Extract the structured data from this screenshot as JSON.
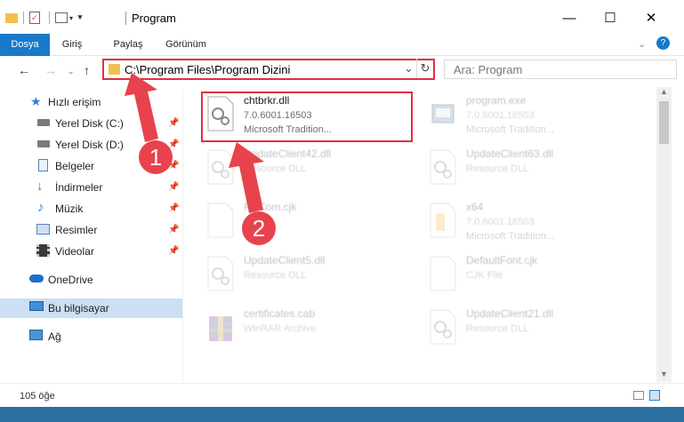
{
  "window": {
    "title": "Program",
    "minimize": "—",
    "maximize": "☐",
    "close": "✕"
  },
  "ribbon": {
    "tabs": [
      "Dosya",
      "Giriş",
      "Paylaş",
      "Görünüm"
    ]
  },
  "address": {
    "path": "C:\\Program Files\\Program Dizini",
    "search_placeholder": "Ara: Program"
  },
  "sidebar": {
    "items": [
      {
        "label": "Hızlı erişim",
        "icon": "star-icon"
      },
      {
        "label": "Yerel Disk (C:)",
        "icon": "drive-icon"
      },
      {
        "label": "Yerel Disk (D:)",
        "icon": "drive-icon"
      },
      {
        "label": "Belgeler",
        "icon": "documents-icon"
      },
      {
        "label": "İndirmeler",
        "icon": "download-icon"
      },
      {
        "label": "Müzik",
        "icon": "music-icon"
      },
      {
        "label": "Resimler",
        "icon": "pictures-icon"
      },
      {
        "label": "Videolar",
        "icon": "video-icon"
      },
      {
        "label": "OneDrive",
        "icon": "cloud-icon"
      },
      {
        "label": "Bu bilgisayar",
        "icon": "computer-icon"
      },
      {
        "label": "Ağ",
        "icon": "network-icon"
      }
    ]
  },
  "files": [
    {
      "name": "chtbrkr.dll",
      "line2": "7.0.6001.16503",
      "line3": "Microsoft Tradition...",
      "icon": "dll-gear-icon"
    },
    {
      "name": "program.exe",
      "line2": "7.0.6001.16503",
      "line3": "Microsoft Tradition...",
      "icon": "exe-icon"
    },
    {
      "name": "UpdateClient42.dll",
      "line2": "Resource DLL",
      "line3": "",
      "icon": "dll-gear-icon"
    },
    {
      "name": "UpdateClient63.dll",
      "line2": "Resource DLL",
      "line3": "",
      "icon": "dll-gear-icon"
    },
    {
      "name": "FixCom.cjk",
      "line2": "",
      "line3": "",
      "icon": "blank-file-icon"
    },
    {
      "name": "x64",
      "line2": "7.0.6001.16503",
      "line3": "Microsoft Tradition...",
      "icon": "folder-file-icon"
    },
    {
      "name": "UpdateClient5.dll",
      "line2": "Resource DLL",
      "line3": "",
      "icon": "dll-gear-icon"
    },
    {
      "name": "DefaultFont.cjk",
      "line2": "CJK File",
      "line3": "",
      "icon": "blank-file-icon"
    },
    {
      "name": "certificates.cab",
      "line2": "WinRAR Archive",
      "line3": "",
      "icon": "archive-icon"
    },
    {
      "name": "UpdateClient21.dll",
      "line2": "Resource DLL",
      "line3": "",
      "icon": "dll-gear-icon"
    }
  ],
  "status": {
    "count": "105 öğe"
  },
  "annotations": {
    "badge1": "1",
    "badge2": "2"
  },
  "colors": {
    "accent": "#1979ca",
    "highlight": "#e03040",
    "badge": "#e8424c"
  }
}
